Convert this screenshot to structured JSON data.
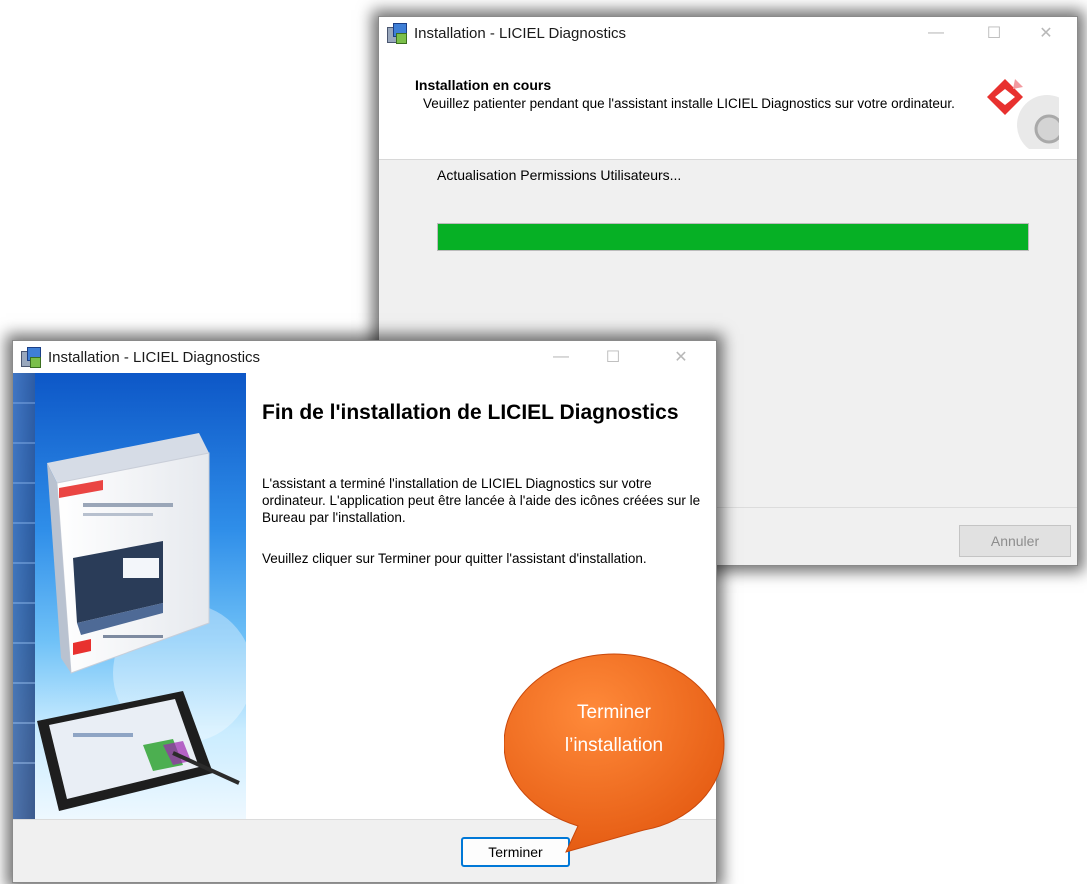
{
  "back_window": {
    "title": "Installation - LICIEL Diagnostics",
    "header_title": "Installation en cours",
    "header_desc": "Veuillez patienter pendant que l'assistant installe LICIEL Diagnostics sur votre ordinateur.",
    "status_text": "Actualisation Permissions Utilisateurs...",
    "progress_percent": 100,
    "cancel_label": "Annuler"
  },
  "front_window": {
    "title": "Installation - LICIEL Diagnostics",
    "heading": "Fin de l'installation de LICIEL Diagnostics",
    "paragraph1": "L'assistant a terminé l'installation de LICIEL Diagnostics sur votre ordinateur. L'application peut être lancée à l'aide des icônes créées sur le Bureau par l'installation.",
    "paragraph2": "Veuillez cliquer sur Terminer pour quitter l'assistant d'installation.",
    "finish_label": "Terminer"
  },
  "callout": {
    "line1": "Terminer",
    "line2": "l’installation"
  },
  "colors": {
    "progress": "#06b025",
    "callout": "#f26a1b",
    "focus_border": "#0078d7",
    "logo_red": "#e8312f"
  },
  "icons": {
    "app": "installer-icon",
    "minimize": "minimize-icon",
    "maximize": "maximize-icon",
    "close": "close-icon",
    "logo": "liciel-logo-icon"
  }
}
